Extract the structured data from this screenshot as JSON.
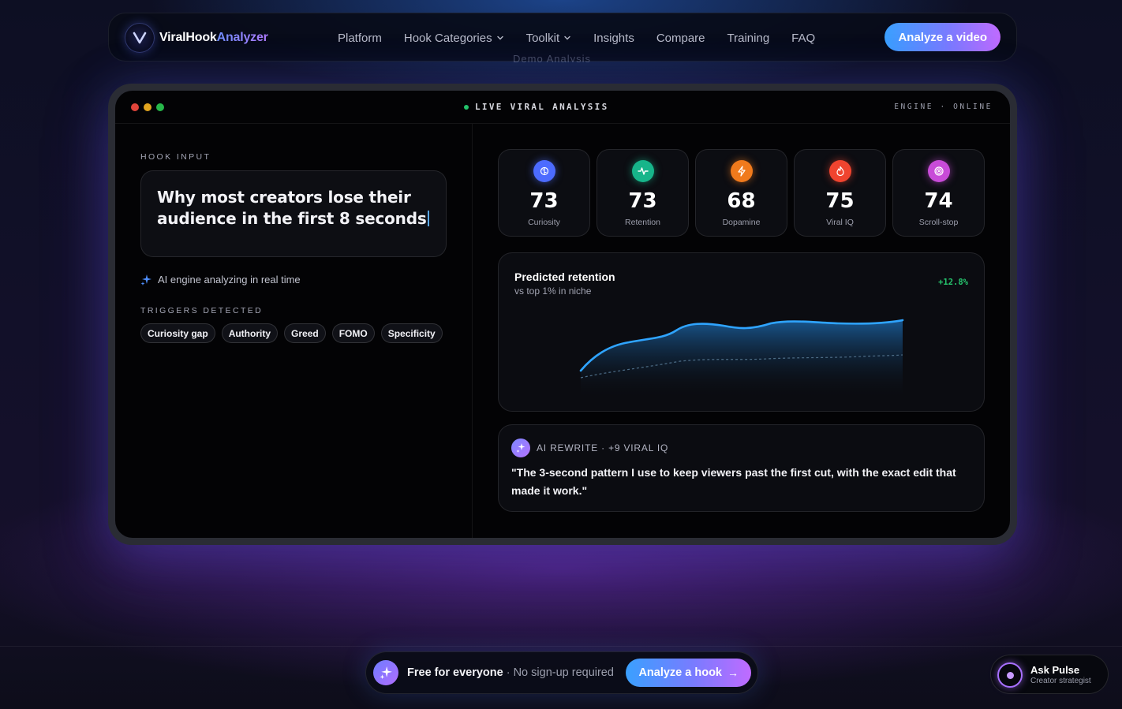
{
  "brand": {
    "name_part1": "ViralHook",
    "name_part2": "Analyzer"
  },
  "nav": {
    "items": [
      {
        "label": "Platform",
        "has_dropdown": false
      },
      {
        "label": "Hook Categories",
        "has_dropdown": true
      },
      {
        "label": "Toolkit",
        "has_dropdown": true
      },
      {
        "label": "Insights",
        "has_dropdown": false
      },
      {
        "label": "Compare",
        "has_dropdown": false
      },
      {
        "label": "Training",
        "has_dropdown": false
      },
      {
        "label": "FAQ",
        "has_dropdown": false
      }
    ],
    "cta_label": "Analyze a video"
  },
  "ghost_text": "Demo Analysis",
  "demo": {
    "live_label": "LIVE VIRAL ANALYSIS",
    "engine_status": "ENGINE · ONLINE",
    "hook_input_label": "HOOK INPUT",
    "hook_text": "Why most creators lose their audience in the first 8 seconds",
    "ai_status": "AI engine analyzing in real time",
    "triggers_label": "TRIGGERS DETECTED",
    "triggers": [
      "Curiosity gap",
      "Authority",
      "Greed",
      "FOMO",
      "Specificity"
    ],
    "metrics": [
      {
        "value": "73",
        "label": "Curiosity",
        "icon": "brain-icon",
        "color": "#4c6bff"
      },
      {
        "value": "73",
        "label": "Retention",
        "icon": "pulse-icon",
        "color": "#17b58a"
      },
      {
        "value": "68",
        "label": "Dopamine",
        "icon": "bolt-icon",
        "color": "#f07a1c"
      },
      {
        "value": "75",
        "label": "Viral IQ",
        "icon": "flame-icon",
        "color": "#f0442f"
      },
      {
        "value": "74",
        "label": "Scroll-stop",
        "icon": "target-icon",
        "color": "#c84bd8"
      }
    ],
    "chart": {
      "title": "Predicted retention",
      "subtitle": "vs top 1% in niche",
      "delta": "+12.8%"
    },
    "rewrite": {
      "header": "AI REWRITE · +9 VIRAL IQ",
      "text": "\"The 3-second pattern I use to keep viewers past the first cut, with the exact edit that made it work.\""
    }
  },
  "bottom": {
    "pill_bold": "Free for everyone",
    "pill_rest": " · No sign-up required",
    "pill_cta": "Analyze a hook",
    "pulse_title": "Ask Pulse",
    "pulse_subtitle": "Creator strategist"
  },
  "colors": {
    "accent_blue": "#3aa0ff",
    "accent_violet": "#c06bff",
    "positive": "#26c66e",
    "line": "#2fa4ff"
  }
}
